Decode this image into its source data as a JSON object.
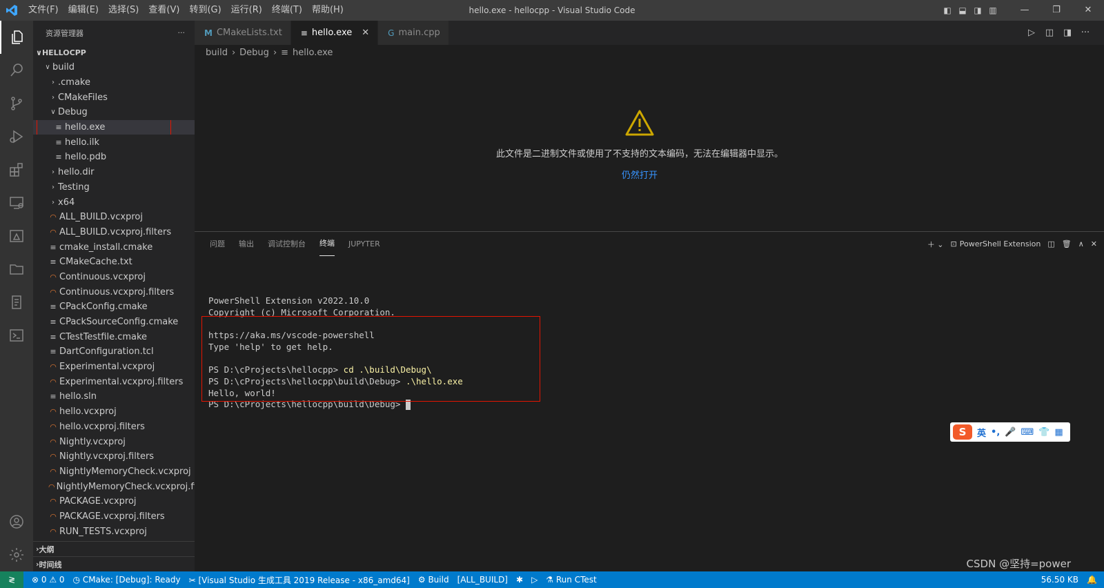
{
  "titlebar": {
    "menu": [
      "文件(F)",
      "编辑(E)",
      "选择(S)",
      "查看(V)",
      "转到(G)",
      "运行(R)",
      "终端(T)",
      "帮助(H)"
    ],
    "title": "hello.exe - hellocpp - Visual Studio Code"
  },
  "sidebar": {
    "title": "资源管理器",
    "more": "···",
    "root": "HELLOCPP",
    "items": [
      {
        "label": "build",
        "kind": "folder-open",
        "depth": 1
      },
      {
        "label": ".cmake",
        "kind": "folder",
        "depth": 2
      },
      {
        "label": "CMakeFiles",
        "kind": "folder",
        "depth": 2
      },
      {
        "label": "Debug",
        "kind": "folder-open",
        "depth": 2
      },
      {
        "label": "hello.exe",
        "kind": "file",
        "depth": 3
      },
      {
        "label": "hello.ilk",
        "kind": "file",
        "depth": 3
      },
      {
        "label": "hello.pdb",
        "kind": "file",
        "depth": 3
      },
      {
        "label": "hello.dir",
        "kind": "folder",
        "depth": 2
      },
      {
        "label": "Testing",
        "kind": "folder",
        "depth": 2
      },
      {
        "label": "x64",
        "kind": "folder",
        "depth": 2
      },
      {
        "label": "ALL_BUILD.vcxproj",
        "kind": "rss",
        "depth": 2
      },
      {
        "label": "ALL_BUILD.vcxproj.filters",
        "kind": "rss",
        "depth": 2
      },
      {
        "label": "cmake_install.cmake",
        "kind": "file",
        "depth": 2
      },
      {
        "label": "CMakeCache.txt",
        "kind": "file",
        "depth": 2
      },
      {
        "label": "Continuous.vcxproj",
        "kind": "rss",
        "depth": 2
      },
      {
        "label": "Continuous.vcxproj.filters",
        "kind": "rss",
        "depth": 2
      },
      {
        "label": "CPackConfig.cmake",
        "kind": "file",
        "depth": 2
      },
      {
        "label": "CPackSourceConfig.cmake",
        "kind": "file",
        "depth": 2
      },
      {
        "label": "CTestTestfile.cmake",
        "kind": "file",
        "depth": 2
      },
      {
        "label": "DartConfiguration.tcl",
        "kind": "file",
        "depth": 2
      },
      {
        "label": "Experimental.vcxproj",
        "kind": "rss",
        "depth": 2
      },
      {
        "label": "Experimental.vcxproj.filters",
        "kind": "rss",
        "depth": 2
      },
      {
        "label": "hello.sln",
        "kind": "file",
        "depth": 2
      },
      {
        "label": "hello.vcxproj",
        "kind": "rss",
        "depth": 2
      },
      {
        "label": "hello.vcxproj.filters",
        "kind": "rss",
        "depth": 2
      },
      {
        "label": "Nightly.vcxproj",
        "kind": "rss",
        "depth": 2
      },
      {
        "label": "Nightly.vcxproj.filters",
        "kind": "rss",
        "depth": 2
      },
      {
        "label": "NightlyMemoryCheck.vcxproj",
        "kind": "rss",
        "depth": 2
      },
      {
        "label": "NightlyMemoryCheck.vcxproj.filt...",
        "kind": "rss",
        "depth": 2
      },
      {
        "label": "PACKAGE.vcxproj",
        "kind": "rss",
        "depth": 2
      },
      {
        "label": "PACKAGE.vcxproj.filters",
        "kind": "rss",
        "depth": 2
      },
      {
        "label": "RUN_TESTS.vcxproj",
        "kind": "rss",
        "depth": 2
      }
    ],
    "outline": "大纲",
    "timeline": "时间线"
  },
  "editor": {
    "tabs": [
      {
        "label": "CMakeLists.txt",
        "icon": "M"
      },
      {
        "label": "hello.exe",
        "icon": "≡"
      },
      {
        "label": "main.cpp",
        "icon": "G"
      }
    ],
    "breadcrumb": [
      "build",
      "Debug",
      "hello.exe"
    ],
    "binary_message": "此文件是二进制文件或使用了不支持的文本编码，无法在编辑器中显示。",
    "open_anyway": "仍然打开"
  },
  "panel": {
    "tabs": [
      "问题",
      "输出",
      "调试控制台",
      "终端",
      "JUPYTER"
    ],
    "terminal_name": "PowerShell Extension",
    "lines": [
      {
        "prompt": "PowerShell Extension v2022.10.0",
        "cmd": ""
      },
      {
        "prompt": "Copyright (c) Microsoft Corporation.",
        "cmd": ""
      },
      {
        "prompt": "",
        "cmd": ""
      },
      {
        "prompt": "https://aka.ms/vscode-powershell",
        "cmd": ""
      },
      {
        "prompt": "Type 'help' to get help.",
        "cmd": ""
      },
      {
        "prompt": "",
        "cmd": ""
      },
      {
        "prompt": "PS D:\\cProjects\\hellocpp> ",
        "cmd": "cd .\\build\\Debug\\"
      },
      {
        "prompt": "PS D:\\cProjects\\hellocpp\\build\\Debug> ",
        "cmd": ".\\hello.exe"
      },
      {
        "prompt": "Hello, world!",
        "cmd": ""
      },
      {
        "prompt": "PS D:\\cProjects\\hellocpp\\build\\Debug> ",
        "cmd": ""
      }
    ]
  },
  "ime": {
    "logo": "S",
    "items": [
      "英",
      "•,",
      "🎤",
      "⌨",
      "👕",
      "▦"
    ]
  },
  "statusbar": {
    "remote": "≷",
    "problems": "⊗ 0 ⚠ 0",
    "cmake": "CMake: [Debug]: Ready",
    "kit": "[Visual Studio 生成工具 2019 Release - x86_amd64]",
    "build": "Build",
    "target": "[ALL_BUILD]",
    "ctest": "Run CTest",
    "size": "56.50 KB"
  },
  "watermark": "CSDN @坚持=power",
  "colors": {
    "accent": "#007acc",
    "highlight": "#e51400",
    "link": "#3794ff",
    "warning": "#cca700"
  }
}
